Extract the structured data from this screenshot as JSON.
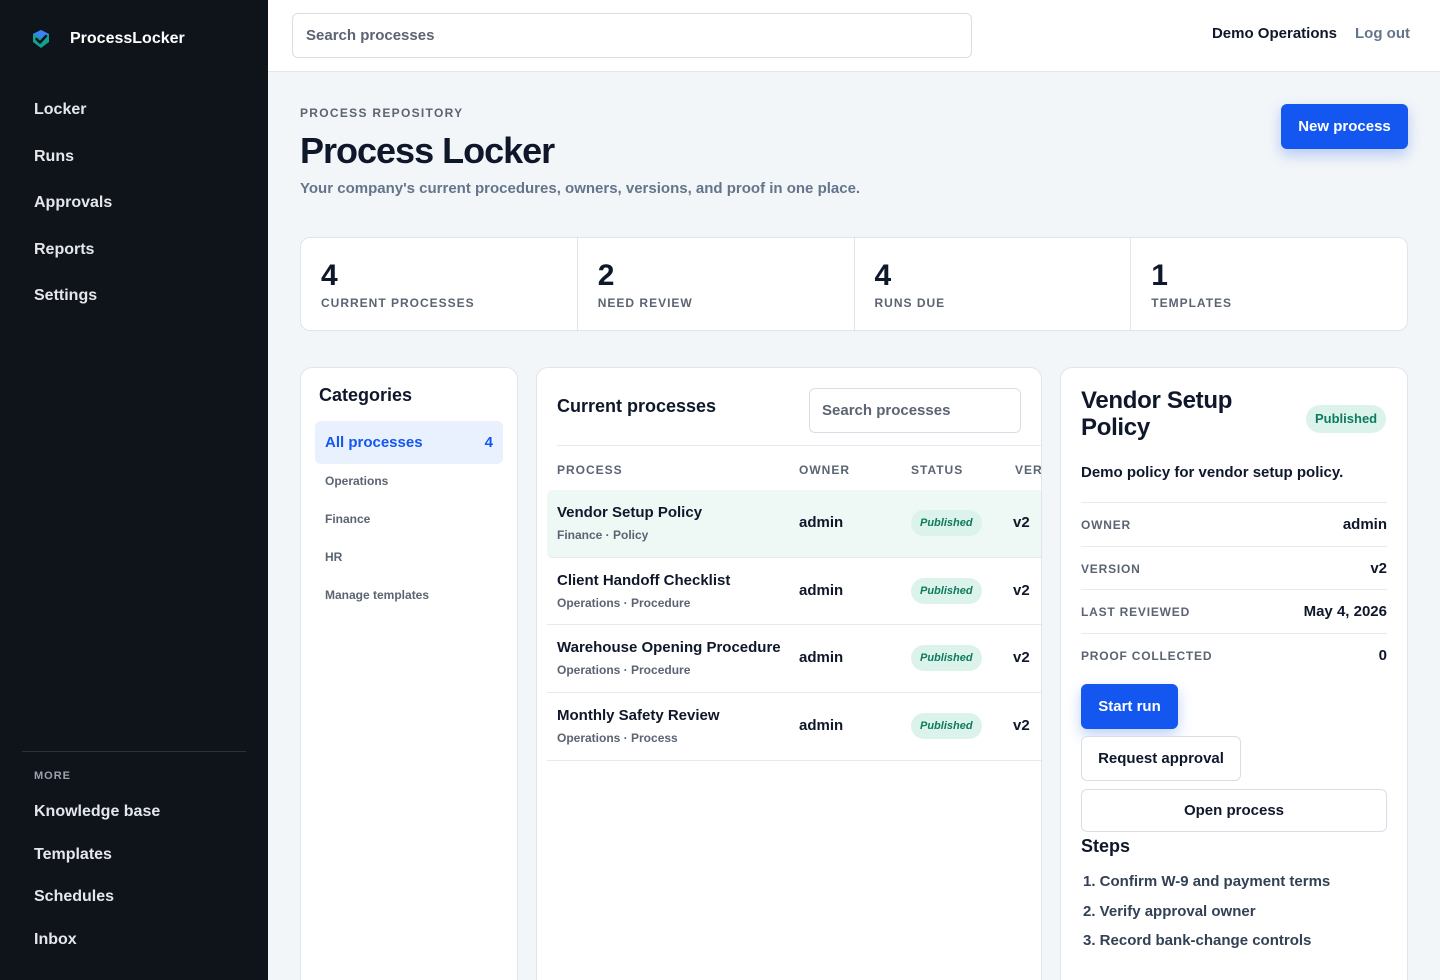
{
  "app": {
    "name": "ProcessLocker"
  },
  "sidebar": {
    "nav": [
      "Locker",
      "Runs",
      "Approvals",
      "Reports",
      "Settings"
    ],
    "more_label": "MORE",
    "more": [
      "Knowledge base",
      "Templates",
      "Schedules",
      "Inbox"
    ]
  },
  "topbar": {
    "search_placeholder": "Search processes",
    "org": "Demo Operations",
    "logout": "Log out"
  },
  "header": {
    "eyebrow": "PROCESS REPOSITORY",
    "title": "Process Locker",
    "subtitle": "Your company's current procedures, owners, versions, and proof in one place.",
    "new_button": "New process"
  },
  "stats": [
    {
      "value": "4",
      "label": "CURRENT PROCESSES"
    },
    {
      "value": "2",
      "label": "NEED REVIEW"
    },
    {
      "value": "4",
      "label": "RUNS DUE"
    },
    {
      "value": "1",
      "label": "TEMPLATES"
    }
  ],
  "categories": {
    "title": "Categories",
    "active": {
      "label": "All processes",
      "count": "4"
    },
    "items": [
      "Operations",
      "Finance",
      "HR",
      "Manage templates"
    ]
  },
  "processes": {
    "title": "Current processes",
    "search_placeholder": "Search processes",
    "columns": [
      "PROCESS",
      "OWNER",
      "STATUS",
      "VER"
    ],
    "rows": [
      {
        "name": "Vendor Setup Policy",
        "meta": "Finance · Policy",
        "owner": "admin",
        "status": "Published",
        "version": "v2"
      },
      {
        "name": "Client Handoff Checklist",
        "meta": "Operations · Procedure",
        "owner": "admin",
        "status": "Published",
        "version": "v2"
      },
      {
        "name": "Warehouse Opening Procedure",
        "meta": "Operations · Procedure",
        "owner": "admin",
        "status": "Published",
        "version": "v2"
      },
      {
        "name": "Monthly Safety Review",
        "meta": "Operations · Process",
        "owner": "admin",
        "status": "Published",
        "version": "v2"
      }
    ]
  },
  "detail": {
    "title": "Vendor Setup Policy",
    "status": "Published",
    "description": "Demo policy for vendor setup policy.",
    "fields": [
      {
        "key": "OWNER",
        "value": "admin"
      },
      {
        "key": "VERSION",
        "value": "v2"
      },
      {
        "key": "LAST REVIEWED",
        "value": "May 4, 2026"
      },
      {
        "key": "PROOF COLLECTED",
        "value": "0"
      }
    ],
    "start_run": "Start run",
    "request_approval": "Request approval",
    "open_process": "Open process",
    "steps_title": "Steps",
    "steps": [
      "1. Confirm W-9 and payment terms",
      "2. Verify approval owner",
      "3. Record bank-change controls"
    ]
  },
  "colors": {
    "accent": "#1456f0",
    "sidebar": "#0f141b",
    "published_bg": "#dcf3ec",
    "published_text": "#0f7a5c"
  }
}
